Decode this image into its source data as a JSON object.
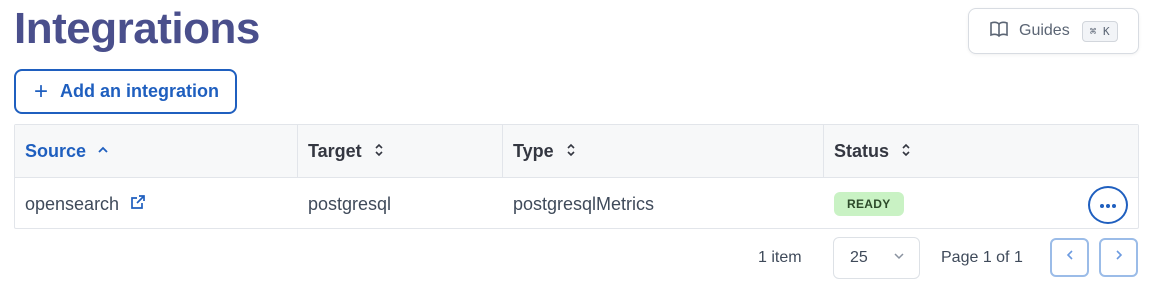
{
  "header": {
    "title": "Integrations",
    "guides_label": "Guides",
    "guides_shortcut": "⌘ K"
  },
  "toolbar": {
    "add_label": "Add an integration"
  },
  "table": {
    "columns": [
      "Source",
      "Target",
      "Type",
      "Status"
    ],
    "sorted_column": "Source",
    "rows": [
      {
        "source": "opensearch",
        "target": "postgresql",
        "type": "postgresqlMetrics",
        "status": "READY"
      }
    ]
  },
  "pagination": {
    "items_label": "1 item",
    "per_page": "25",
    "page_label": "Page 1 of 1"
  },
  "colors": {
    "title": "#4a4f8c",
    "accent": "#1f5fbf",
    "ready_badge_bg": "#c9f2c4"
  }
}
